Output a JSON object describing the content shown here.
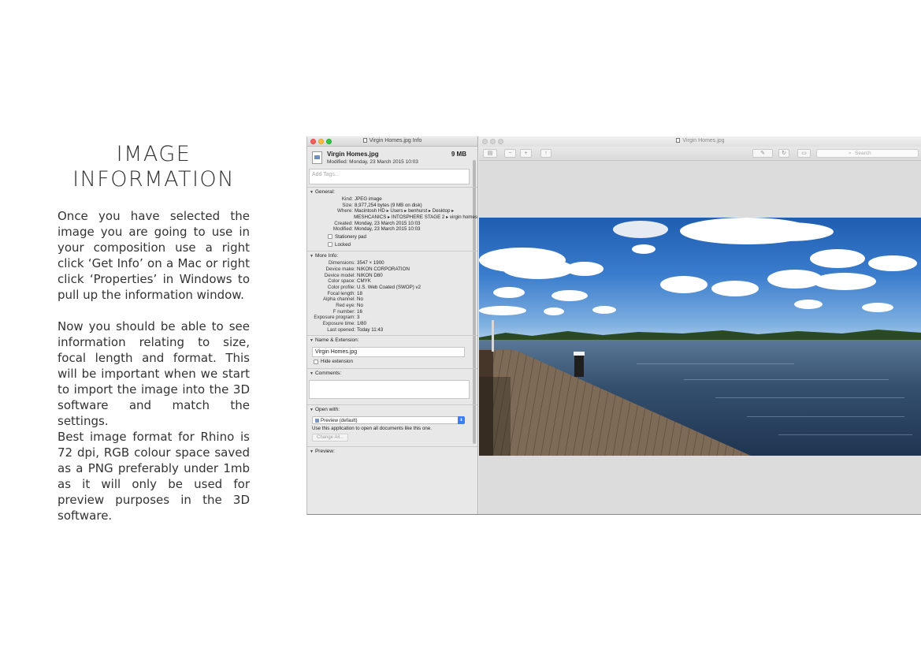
{
  "slide": {
    "heading_line1": "IMAGE",
    "heading_line2": "INFORMATION",
    "paragraph1": "Once you have selected the image you are going to use in your composition use a right click ‘Get Info’ on a Mac or right click ‘Properties’ in Windows to pull up the information window.",
    "paragraph2": "Now you should be able to see information relating to size, focal length and format. This will be important when we start to import the image into the 3D software and match the settings.",
    "paragraph3": "Best image format for Rhino is 72 dpi, RGB colour space saved as a PNG preferably under 1mb as it will only be used for preview purposes in the 3D software."
  },
  "info_window": {
    "title": "Virgin Homes.jpg Info",
    "file_name": "Virgin Homes.jpg",
    "file_size": "9 MB",
    "modified": "Modified: Monday, 23 March 2015 10:03",
    "tags_placeholder": "Add Tags...",
    "general": {
      "header": "General:",
      "rows": [
        {
          "k": "Kind:",
          "v": "JPEG image"
        },
        {
          "k": "Size:",
          "v": "8,977,254 bytes (9 MB on disk)"
        },
        {
          "k": "Where:",
          "v": "Macintosh HD ▸ Users ▸ benhurst ▸ Desktop ▸"
        },
        {
          "k": "",
          "v": "MESHCANICS ▸ INTOSPHERE STAGE 2 ▸ virgin homes"
        },
        {
          "k": "Created:",
          "v": "Monday, 23 March 2015 10:03"
        },
        {
          "k": "Modified:",
          "v": "Monday, 23 March 2015 10:03"
        }
      ],
      "stationery_label": "Stationery pad",
      "locked_label": "Locked"
    },
    "more_info": {
      "header": "More Info:",
      "rows": [
        {
          "k": "Dimensions:",
          "v": "3547 × 1900"
        },
        {
          "k": "Device make:",
          "v": "NIKON CORPORATION"
        },
        {
          "k": "Device model:",
          "v": "NIKON D80"
        },
        {
          "k": "Color space:",
          "v": "CMYK"
        },
        {
          "k": "Color profile:",
          "v": "U.S. Web Coated (SWOP) v2"
        },
        {
          "k": "Focal length:",
          "v": "18"
        },
        {
          "k": "Alpha channel:",
          "v": "No"
        },
        {
          "k": "Red eye:",
          "v": "No"
        },
        {
          "k": "F number:",
          "v": "16"
        },
        {
          "k": "Exposure program:",
          "v": "3"
        },
        {
          "k": "Exposure time:",
          "v": "1/80"
        },
        {
          "k": "Last opened:",
          "v": "Today 11:43"
        }
      ]
    },
    "name_extension": {
      "header": "Name & Extension:",
      "value": "Virgin Homes.jpg",
      "hide_extension_label": "Hide extension"
    },
    "comments": {
      "header": "Comments:"
    },
    "open_with": {
      "header": "Open with:",
      "selected": "Preview (default)",
      "description": "Use this application to open all documents like this one.",
      "change_all_label": "Change All..."
    },
    "preview": {
      "header": "Preview:"
    }
  },
  "viewer": {
    "title": "Virgin Homes.jpg",
    "search_placeholder": "Search"
  },
  "icons": [
    "close-icon",
    "minimize-icon",
    "zoom-icon",
    "sidebar-icon",
    "zoom-out-icon",
    "zoom-in-icon",
    "share-icon",
    "markup-icon",
    "rotate-icon",
    "toolbox-icon",
    "search-icon"
  ],
  "colors": {
    "sky": "#3a7ccd",
    "water": "#34506e",
    "select_accent": "#3b7ff3"
  }
}
